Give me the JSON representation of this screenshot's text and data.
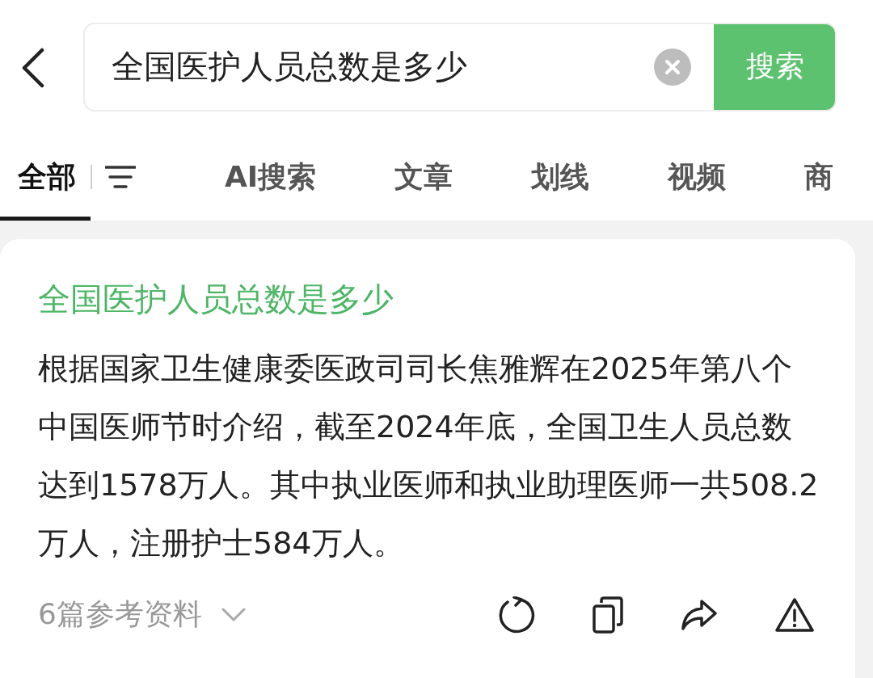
{
  "search": {
    "value": "全国医护人员总数是多少",
    "button": "搜索"
  },
  "tabs": [
    {
      "label": "全部",
      "selected": true
    },
    {
      "label": "AI搜索",
      "selected": false
    },
    {
      "label": "文章",
      "selected": false
    },
    {
      "label": "划线",
      "selected": false
    },
    {
      "label": "视频",
      "selected": false
    },
    {
      "label": "商",
      "selected": false
    }
  ],
  "answer": {
    "title": "全国医护人员总数是多少",
    "text": "根据国家卫生健康委医政司司长焦雅辉在2025年第八个中国医师节时介绍，截至2024年底，全国卫生人员总数达到1578万人。其中执业医师和执业助理医师一共508.2万人，注册护士584万人。",
    "references": "6篇参考资料"
  }
}
